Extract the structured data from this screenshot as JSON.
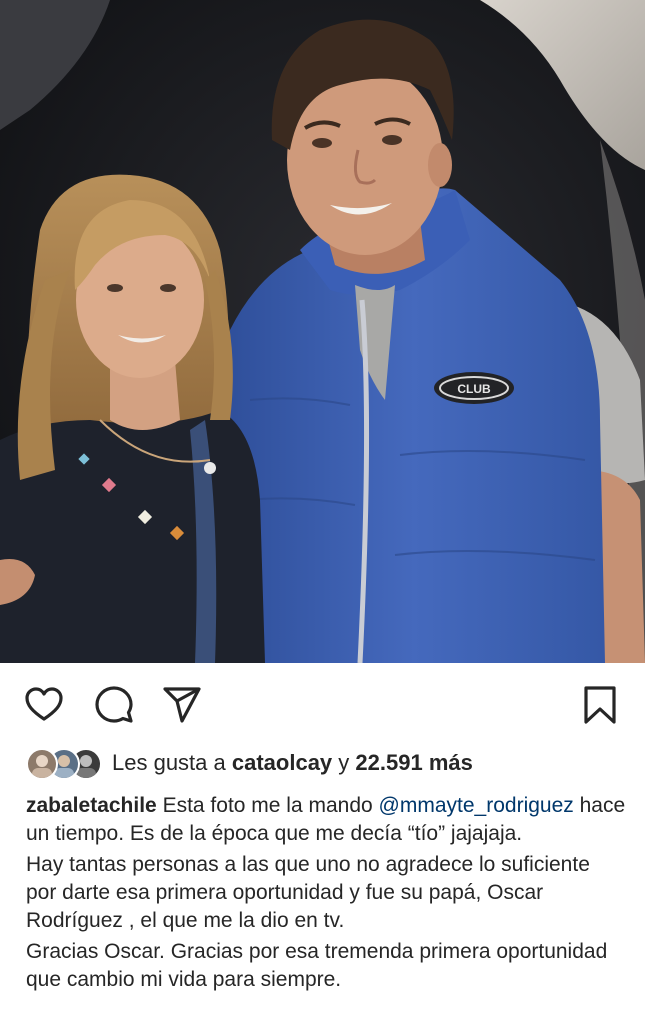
{
  "post": {
    "photo": {
      "jacket_logo_text": "CLUB",
      "description_hidden": true
    }
  },
  "actions": {
    "like_icon": "heart-outline-icon",
    "comment_icon": "comment-bubble-icon",
    "share_icon": "paper-plane-icon",
    "save_icon": "bookmark-outline-icon"
  },
  "likes": {
    "prefix": "Les gusta a",
    "user": "cataolcay",
    "connector": "y",
    "count": "22.591 más"
  },
  "caption": {
    "username": "zabaletachile",
    "line1_text": "Esta foto me la mando",
    "mention": "@mmayte_rodriguez",
    "line1_rest": "hace un tiempo. Es de la época que me decía “tío” jajajaja.",
    "paragraph2": "Hay tantas personas a las que uno no agradece lo suficiente por darte esa primera oportunidad y fue su papá, Oscar Rodríguez , el que me  la dio en tv.",
    "paragraph3": "Gracias Oscar.  Gracias por esa tremenda primera oportunidad que cambio mi vida para siempre."
  },
  "colors": {
    "text": "#262626",
    "mention": "#00376b",
    "jacket": "#3d5fb0",
    "background": "#ffffff"
  }
}
